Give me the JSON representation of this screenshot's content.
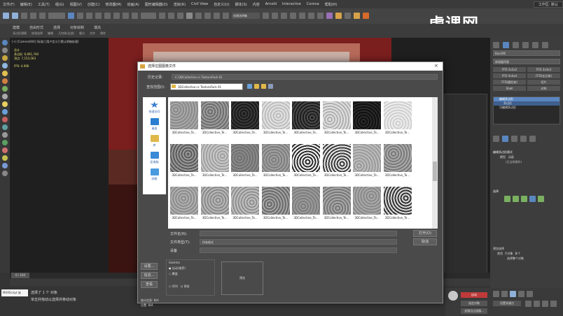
{
  "menu": [
    "文件(F)",
    "编辑(E)",
    "工具(T)",
    "组(G)",
    "视图(V)",
    "创建(C)",
    "修改器(M)",
    "动画(A)",
    "图形编辑器(D)",
    "渲染(R)",
    "Civil View",
    "自定义(U)",
    "脚本(S)",
    "内容",
    "Arnold",
    "Interactive",
    "Corona",
    "帮助(H)"
  ],
  "workspace": "工作区: 默认",
  "toolbar2_labels": [
    "建模",
    "自由形式",
    "选择",
    "对象绘制",
    "填充"
  ],
  "toolbar2_sub": [
    "多边形建模",
    "修改选择",
    "编辑",
    "几何体(全部)",
    "细分",
    "对齐",
    "属性"
  ],
  "selection_set": "创建选择集",
  "viewport_label": "[+] [Camera004] [标准] [用户定义] [默认明暗处理]",
  "stats": {
    "title": "总计",
    "polys_label": "多边形:",
    "polys": "6,061,740",
    "verts_label": "顶点:",
    "verts": "7,153,563",
    "fps_label": "FPS:",
    "fps": "4.096"
  },
  "watermark": "虎课网",
  "dialog": {
    "title": "选择位图图像文件",
    "history_label": "历史记录:",
    "history_value": "C:\\3DCollective.cc TextureFack 01",
    "lookin_label": "查找范围(I):",
    "lookin_value": "3DCollective.cc TextureFack 01",
    "places": [
      "快速访问",
      "桌面",
      "库",
      "此电脑",
      "网络"
    ],
    "thumb_caption": "3DCollective_Te...",
    "filename_label": "文件名(N):",
    "filetype_label": "文件类型(T):",
    "filetype_value": "所有格式",
    "devices_label": "设备",
    "open_button": "打开(O)",
    "cancel_button": "取消",
    "side_buttons": [
      "设置...",
      "信息...",
      "查看"
    ],
    "gamma_label": "Gamma",
    "gamma_auto": "自动(推荐)",
    "gamma_override": "覆盖",
    "sequence_label": "序列",
    "preview_label": "预览",
    "stats_label": "统计信息:",
    "stats_value": "N/A",
    "location_label": "位置:",
    "location_value": "N/A"
  },
  "right_panel": {
    "object_name": "Box396",
    "modifier_list": "修改器列表",
    "buttons": [
      "FFD 2x2x2",
      "FFD 3x3x3",
      "FFD 4x4x4",
      "FFD(长方体)",
      "FFD(圆柱体)",
      "切片",
      "Shell",
      "对称"
    ],
    "stack": [
      "编辑多边形",
      "多边形",
      "可编辑多边形"
    ],
    "section1": "编辑多边形模式",
    "mode_model": "模型",
    "mode_anim": "动画",
    "no_op": "(无当前操作)",
    "section2": "选择",
    "preview_select": "预览选择",
    "off": "禁用",
    "subobj": "子对象",
    "multi": "多个",
    "selected_count": "选择整个对象"
  },
  "bottom": {
    "maxscript": "MAXScript 迷",
    "status1": "选择了 1 个 对象",
    "status2": "单击并拖动以选择并移动对象",
    "frame": "0 / 100",
    "auto_key": "自动",
    "selected": "选定对象",
    "set_key": "设置关键点",
    "filter": "关键点过滤器..."
  }
}
